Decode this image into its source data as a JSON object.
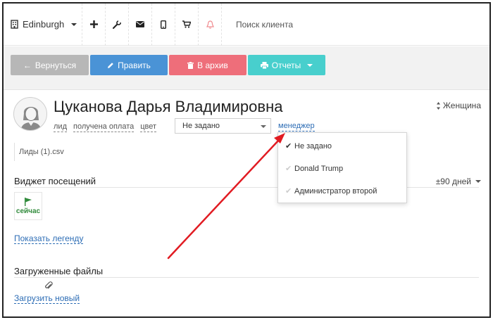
{
  "nav": {
    "city": "Edinburgh",
    "search_placeholder": "Поиск клиента",
    "icons": [
      "building-icon",
      "plus-icon",
      "wrench-icon",
      "envelope-icon",
      "mobile-icon",
      "cart-icon",
      "bell-icon"
    ]
  },
  "toolbar": {
    "back_label": "Вернуться",
    "edit_label": "Править",
    "archive_label": "В архив",
    "reports_label": "Отчеты"
  },
  "client": {
    "name": "Цуканова Дарья Владимировна",
    "gender": "Женщина",
    "tags": [
      "лид",
      "получена оплата",
      "цвет"
    ],
    "select_value": "Не задано",
    "manager_label": "менеджер",
    "file_name": "Лиды (1).csv"
  },
  "dropdown": {
    "items": [
      {
        "label": "Не задано",
        "selected": true
      },
      {
        "label": "Donald Trump",
        "selected": false
      },
      {
        "label": "Администратор второй",
        "selected": false
      }
    ]
  },
  "visits": {
    "title": "Виджет посещений",
    "period": "±90 дней",
    "now_label": "сейчас",
    "legend_link": "Показать легенду"
  },
  "files": {
    "title": "Загруженные файлы",
    "upload_link": "Загрузить новый"
  },
  "colors": {
    "back": "#b7b7b7",
    "edit": "#4a93d6",
    "archive": "#ee6e7a",
    "reports": "#48cfcd",
    "link": "#2d6db5",
    "arrow": "#e11b22",
    "flag": "#2f8a3a"
  }
}
